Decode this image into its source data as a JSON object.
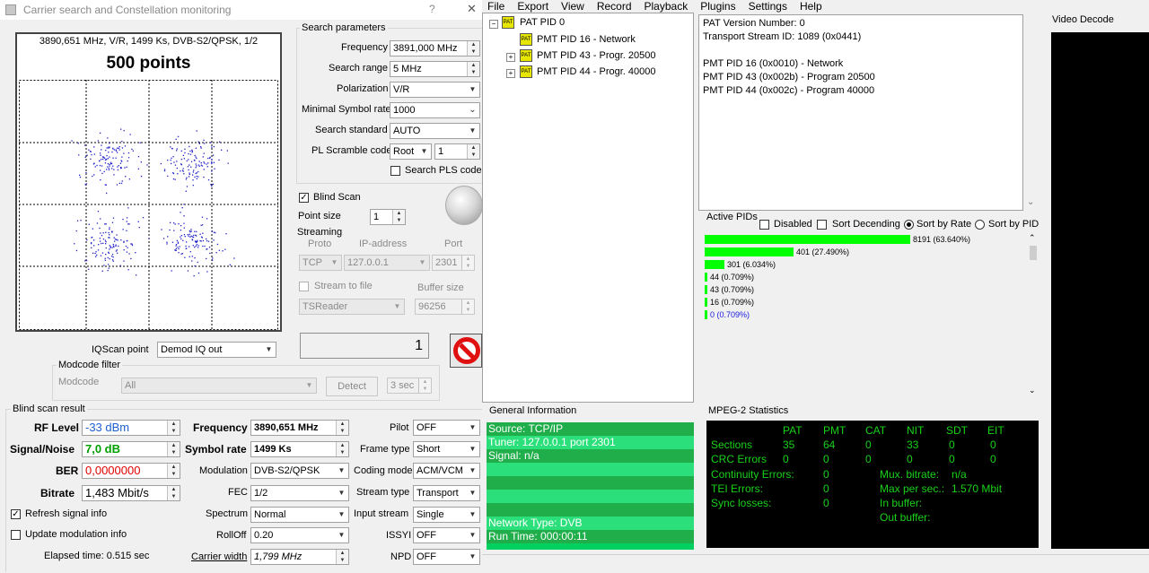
{
  "left_window": {
    "title": "Carrier search and Constellation monitoring",
    "help_button": "?",
    "close_button": "✕",
    "constellation": {
      "info": "3890,651 MHz, V/R, 1499 Ks, DVB-S2/QPSK, 1/2",
      "points_label": "500 points"
    },
    "search_params": {
      "title": "Search parameters",
      "frequency_label": "Frequency",
      "frequency_value": "3891,000 MHz",
      "range_label": "Search range",
      "range_value": "5 MHz",
      "polarization_label": "Polarization",
      "polarization_value": "V/R",
      "min_sr_label": "Minimal Symbol rate",
      "min_sr_value": "1000",
      "standard_label": "Search standard",
      "standard_value": "AUTO",
      "pls_label": "PL Scramble code",
      "pls_mode": "Root",
      "pls_value": "1",
      "search_pls_label": "Search PLS code"
    },
    "blind_scan_label": "Blind Scan",
    "point_size_label": "Point size",
    "point_size_value": "1",
    "streaming": {
      "title": "Streaming",
      "proto_label": "Proto",
      "ip_label": "IP-address",
      "port_label": "Port",
      "proto_value": "TCP",
      "ip_value": "127.0.0.1",
      "port_value": "2301",
      "stream_to_file_label": "Stream to file",
      "buffer_label": "Buffer size",
      "reader_value": "TSReader",
      "buffer_value": "96256"
    },
    "iqscan_label": "IQScan point",
    "iqscan_value": "Demod IQ out",
    "modcode": {
      "title": "Modcode filter",
      "label": "Modcode",
      "value": "All",
      "detect_button": "Detect",
      "timer_value": "3 sec"
    },
    "result": {
      "title": "Blind scan result",
      "rf_label": "RF Level",
      "rf_value": "-33 dBm",
      "sn_label": "Signal/Noise",
      "sn_value": "7,0 dB",
      "ber_label": "BER",
      "ber_value": "0,0000000",
      "bitrate_label": "Bitrate",
      "bitrate_value": "1,483 Mbit/s",
      "freq_label": "Frequency",
      "freq_value": "3890,651 MHz",
      "sr_label": "Symbol rate",
      "sr_value": "1499 Ks",
      "modulation_label": "Modulation",
      "modulation_value": "DVB-S2/QPSK",
      "fec_label": "FEC",
      "fec_value": "1/2",
      "spectrum_label": "Spectrum",
      "spectrum_value": "Normal",
      "rolloff_label": "RollOff",
      "rolloff_value": "0.20",
      "carrier_width_label": "Carrier width",
      "carrier_width_value": "1,799 MHz",
      "pilot_label": "Pilot",
      "pilot_value": "OFF",
      "frame_label": "Frame type",
      "frame_value": "Short",
      "coding_label": "Coding mode",
      "coding_value": "ACM/VCM",
      "stream_type_label": "Stream type",
      "stream_type_value": "Transport",
      "input_stream_label": "Input stream",
      "input_stream_value": "Single",
      "issyi_label": "ISSYI",
      "issyi_value": "OFF",
      "npd_label": "NPD",
      "npd_value": "OFF"
    },
    "refresh_label": "Refresh signal info",
    "update_mod_label": "Update modulation info",
    "elapsed": "Elapsed time: 0.515 sec",
    "lcd_value": "1"
  },
  "right_window": {
    "menu": [
      "File",
      "Export",
      "View",
      "Record",
      "Playback",
      "Plugins",
      "Settings",
      "Help"
    ],
    "tree": {
      "root": "PAT PID 0",
      "items": [
        "PMT PID 16 - Network",
        "PMT PID 43 - Progr. 20500",
        "PMT PID 44 - Progr. 40000"
      ],
      "icon_text": "PAT"
    },
    "pat_info": [
      "PAT Version Number: 0",
      "Transport Stream ID: 1089 (0x0441)",
      "",
      "PMT PID 16 (0x0010) - Network",
      "PMT PID 43 (0x002b) - Program 20500",
      "PMT PID 44 (0x002c) - Program 40000"
    ],
    "video_decode_title": "Video Decode",
    "active_pids": {
      "title": "Active PIDs",
      "disabled_label": "Disabled",
      "sort_desc_label": "Sort Decending",
      "sort_rate_label": "Sort by Rate",
      "sort_pid_label": "Sort by PID",
      "rows": [
        {
          "label": "8191 (63.640%)",
          "share": 0.6364
        },
        {
          "label": "401 (27.490%)",
          "share": 0.2749
        },
        {
          "label": "301 (6.034%)",
          "share": 0.06034
        },
        {
          "label": "44 (0.709%)",
          "share": 0.00709
        },
        {
          "label": "43 (0.709%)",
          "share": 0.00709
        },
        {
          "label": "16 (0.709%)",
          "share": 0.00709
        },
        {
          "label": "0 (0.709%)",
          "share": 0.00709
        }
      ]
    },
    "general_info": {
      "title": "General Information",
      "lines": [
        "Source: TCP/IP",
        "Tuner: 127.0.0.1 port 2301",
        "Signal: n/a",
        "",
        "",
        "",
        "",
        "Network Type: DVB",
        "Run Time: 000:00:11"
      ]
    },
    "mpeg_stats": {
      "title": "MPEG-2 Statistics",
      "headers": [
        "PAT",
        "PMT",
        "CAT",
        "NIT",
        "SDT",
        "EIT"
      ],
      "sections_label": "Sections",
      "sections": [
        "35",
        "64",
        "0",
        "33",
        "0",
        "0"
      ],
      "crc_label": "CRC Errors",
      "crc": [
        "0",
        "0",
        "0",
        "0",
        "0",
        "0"
      ],
      "continuity_label": "Continuity Errors:",
      "continuity_value": "0",
      "tei_label": "TEI Errors:",
      "tei_value": "0",
      "sync_label": "Sync losses:",
      "sync_value": "0",
      "mux_label": "Mux. bitrate:",
      "mux_value": "n/a",
      "max_label": "Max per sec.:",
      "max_value": "1.570 Mbit",
      "inbuf_label": "In buffer:",
      "outbuf_label": "Out buffer:"
    }
  }
}
